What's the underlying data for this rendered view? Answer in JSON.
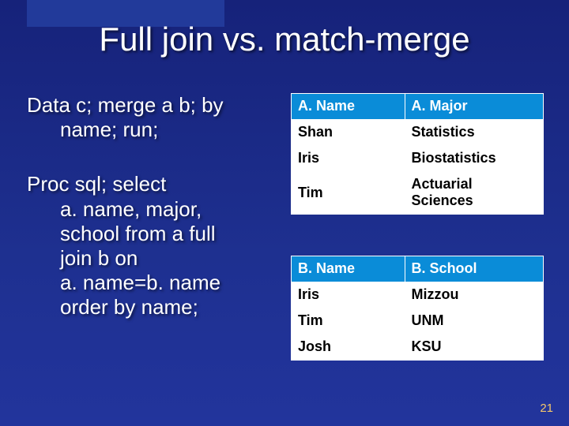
{
  "title": "Full join vs. match-merge",
  "code1": {
    "line1": "Data c; merge a b; by",
    "line2": "name; run;"
  },
  "code2": {
    "line1": "Proc sql; select",
    "line2": "a. name, major,",
    "line3": "school from a full",
    "line4": "join b on",
    "line5": "a. name=b. name",
    "line6": "order by name;"
  },
  "tableA": {
    "headers": [
      "A. Name",
      "A. Major"
    ],
    "rows": [
      [
        "Shan",
        "Statistics"
      ],
      [
        "Iris",
        "Biostatistics"
      ],
      [
        "Tim",
        "Actuarial Sciences"
      ]
    ]
  },
  "tableB": {
    "headers": [
      "B. Name",
      "B. School"
    ],
    "rows": [
      [
        "Iris",
        "Mizzou"
      ],
      [
        "Tim",
        "UNM"
      ],
      [
        "Josh",
        "KSU"
      ]
    ]
  },
  "pageNumber": "21"
}
